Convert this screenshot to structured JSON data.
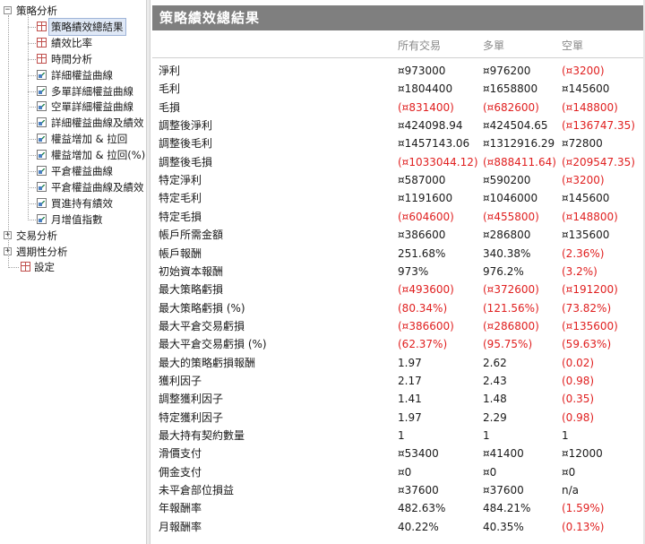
{
  "tree": {
    "nodes": [
      {
        "label": "策略分析",
        "level": 0,
        "expander": "−",
        "icon": "none"
      },
      {
        "label": "策略績效總結果",
        "level": 1,
        "icon": "table-icon",
        "selected": true
      },
      {
        "label": "績效比率",
        "level": 1,
        "icon": "table-icon"
      },
      {
        "label": "時間分析",
        "level": 1,
        "icon": "table-icon"
      },
      {
        "label": "詳細權益曲線",
        "level": 1,
        "icon": "chart-icon"
      },
      {
        "label": "多單詳細權益曲線",
        "level": 1,
        "icon": "chart-icon"
      },
      {
        "label": "空單詳細權益曲線",
        "level": 1,
        "icon": "chart-icon"
      },
      {
        "label": "詳細權益曲線及績效",
        "level": 1,
        "icon": "chart-icon"
      },
      {
        "label": "權益增加 & 拉回",
        "level": 1,
        "icon": "chart-icon"
      },
      {
        "label": "權益增加 & 拉回(%)",
        "level": 1,
        "icon": "chart-icon"
      },
      {
        "label": "平倉權益曲線",
        "level": 1,
        "icon": "chart-icon"
      },
      {
        "label": "平倉權益曲線及績效",
        "level": 1,
        "icon": "chart-icon"
      },
      {
        "label": "買進持有績效",
        "level": 1,
        "icon": "chart-icon"
      },
      {
        "label": "月增值指數",
        "level": 1,
        "icon": "chart-icon"
      },
      {
        "label": "交易分析",
        "level": 0,
        "expander": "+",
        "icon": "none"
      },
      {
        "label": "週期性分析",
        "level": 0,
        "expander": "+",
        "icon": "none"
      },
      {
        "label": "設定",
        "level": 0,
        "icon": "table-icon"
      }
    ]
  },
  "report": {
    "title": "策略績效總結果",
    "columns": [
      "所有交易",
      "多單",
      "空單"
    ],
    "rows": [
      {
        "label": "淨利",
        "values": [
          "¤973000",
          "¤976200",
          "(¤3200)"
        ],
        "neg": [
          false,
          false,
          true
        ]
      },
      {
        "label": "毛利",
        "values": [
          "¤1804400",
          "¤1658800",
          "¤145600"
        ],
        "neg": [
          false,
          false,
          false
        ]
      },
      {
        "label": "毛損",
        "values": [
          "(¤831400)",
          "(¤682600)",
          "(¤148800)"
        ],
        "neg": [
          true,
          true,
          true
        ]
      },
      {
        "label": "調整後淨利",
        "values": [
          "¤424098.94",
          "¤424504.65",
          "(¤136747.35)"
        ],
        "neg": [
          false,
          false,
          true
        ]
      },
      {
        "label": "調整後毛利",
        "values": [
          "¤1457143.06",
          "¤1312916.29",
          "¤72800"
        ],
        "neg": [
          false,
          false,
          false
        ]
      },
      {
        "label": "調整後毛損",
        "values": [
          "(¤1033044.12)",
          "(¤888411.64)",
          "(¤209547.35)"
        ],
        "neg": [
          true,
          true,
          true
        ]
      },
      {
        "label": "特定淨利",
        "values": [
          "¤587000",
          "¤590200",
          "(¤3200)"
        ],
        "neg": [
          false,
          false,
          true
        ]
      },
      {
        "label": "特定毛利",
        "values": [
          "¤1191600",
          "¤1046000",
          "¤145600"
        ],
        "neg": [
          false,
          false,
          false
        ]
      },
      {
        "label": "特定毛損",
        "values": [
          "(¤604600)",
          "(¤455800)",
          "(¤148800)"
        ],
        "neg": [
          true,
          true,
          true
        ]
      },
      {
        "label": "帳戶所需金額",
        "values": [
          "¤386600",
          "¤286800",
          "¤135600"
        ],
        "neg": [
          false,
          false,
          false
        ]
      },
      {
        "label": "帳戶報酬",
        "values": [
          "251.68%",
          "340.38%",
          "(2.36%)"
        ],
        "neg": [
          false,
          false,
          true
        ]
      },
      {
        "label": "初始資本報酬",
        "values": [
          "973%",
          "976.2%",
          "(3.2%)"
        ],
        "neg": [
          false,
          false,
          true
        ]
      },
      {
        "label": "最大策略虧損",
        "values": [
          "(¤493600)",
          "(¤372600)",
          "(¤191200)"
        ],
        "neg": [
          true,
          true,
          true
        ]
      },
      {
        "label": "最大策略虧損 (%)",
        "values": [
          "(80.34%)",
          "(121.56%)",
          "(73.82%)"
        ],
        "neg": [
          true,
          true,
          true
        ]
      },
      {
        "label": "最大平倉交易虧損",
        "values": [
          "(¤386600)",
          "(¤286800)",
          "(¤135600)"
        ],
        "neg": [
          true,
          true,
          true
        ]
      },
      {
        "label": "最大平倉交易虧損 (%)",
        "values": [
          "(62.37%)",
          "(95.75%)",
          "(59.63%)"
        ],
        "neg": [
          true,
          true,
          true
        ]
      },
      {
        "label": "最大的策略虧損報酬",
        "values": [
          "1.97",
          "2.62",
          "(0.02)"
        ],
        "neg": [
          false,
          false,
          true
        ]
      },
      {
        "label": "獲利因子",
        "values": [
          "2.17",
          "2.43",
          "(0.98)"
        ],
        "neg": [
          false,
          false,
          true
        ]
      },
      {
        "label": "調整獲利因子",
        "values": [
          "1.41",
          "1.48",
          "(0.35)"
        ],
        "neg": [
          false,
          false,
          true
        ]
      },
      {
        "label": "特定獲利因子",
        "values": [
          "1.97",
          "2.29",
          "(0.98)"
        ],
        "neg": [
          false,
          false,
          true
        ]
      },
      {
        "label": "最大持有契約數量",
        "values": [
          "1",
          "1",
          "1"
        ],
        "neg": [
          false,
          false,
          false
        ]
      },
      {
        "label": "滑價支付",
        "values": [
          "¤53400",
          "¤41400",
          "¤12000"
        ],
        "neg": [
          false,
          false,
          false
        ]
      },
      {
        "label": "佣金支付",
        "values": [
          "¤0",
          "¤0",
          "¤0"
        ],
        "neg": [
          false,
          false,
          false
        ]
      },
      {
        "label": "未平倉部位損益",
        "values": [
          "¤37600",
          "¤37600",
          "n/a"
        ],
        "neg": [
          false,
          false,
          false
        ]
      },
      {
        "label": "年報酬率",
        "values": [
          "482.63%",
          "484.21%",
          "(1.59%)"
        ],
        "neg": [
          false,
          false,
          true
        ]
      },
      {
        "label": "月報酬率",
        "values": [
          "40.22%",
          "40.35%",
          "(0.13%)"
        ],
        "neg": [
          false,
          false,
          true
        ]
      }
    ]
  },
  "colors": {
    "title_bg": "#7f7f7f",
    "negative": "#e02020",
    "column_header": "#8a8a8a"
  }
}
